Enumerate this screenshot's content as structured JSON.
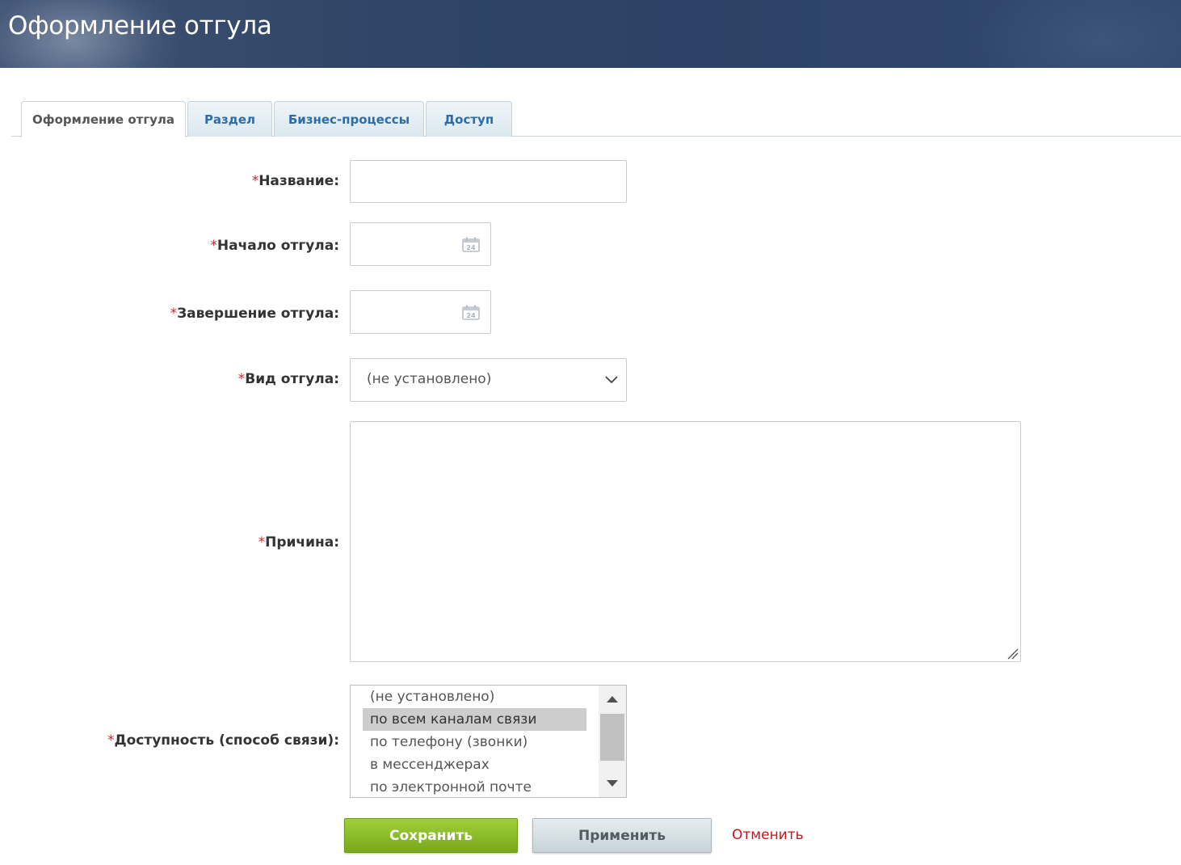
{
  "header": {
    "title": "Оформление отгула"
  },
  "tabs": [
    {
      "label": "Оформление отгула",
      "active": true
    },
    {
      "label": "Раздел",
      "active": false
    },
    {
      "label": "Бизнес-процессы",
      "active": false
    },
    {
      "label": "Доступ",
      "active": false
    }
  ],
  "form": {
    "required_mark": "*",
    "name": {
      "label": "Название:",
      "value": ""
    },
    "start": {
      "label": "Начало отгула:",
      "value": "",
      "icon": "calendar-icon",
      "icon_text": "24"
    },
    "end": {
      "label": "Завершение отгула:",
      "value": "",
      "icon": "calendar-icon",
      "icon_text": "24"
    },
    "type": {
      "label": "Вид отгула:",
      "value": "(не установлено)",
      "icon": "chevron-down-icon"
    },
    "reason": {
      "label": "Причина:",
      "value": ""
    },
    "availability": {
      "label": "Доступность (способ связи):",
      "options": [
        {
          "label": "(не установлено)",
          "selected": false
        },
        {
          "label": "по всем каналам связи",
          "selected": true
        },
        {
          "label": "по телефону (звонки)",
          "selected": false
        },
        {
          "label": "в мессенджерах",
          "selected": false
        },
        {
          "label": "по электронной почте",
          "selected": false
        }
      ]
    }
  },
  "actions": {
    "save_label": "Сохранить",
    "apply_label": "Применить",
    "cancel_label": "Отменить"
  },
  "colors": {
    "required": "#d9232e",
    "tab_link": "#2d6ca5",
    "save_button": "#8cbf28",
    "cancel_link": "#c8141b"
  }
}
